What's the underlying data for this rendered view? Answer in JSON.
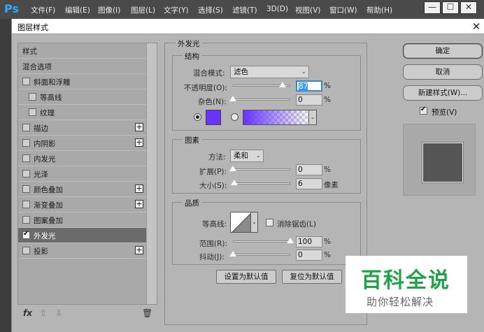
{
  "app": {
    "logo": "Ps",
    "menus": [
      "文件(F)",
      "编辑(E)",
      "图像(I)",
      "图层(L)",
      "文字(Y)",
      "选择(S)",
      "滤镜(T)",
      "3D(D)",
      "视图(V)",
      "窗口(W)",
      "帮助(H)"
    ],
    "window_buttons": [
      "—",
      "☐",
      "✕"
    ]
  },
  "dialog": {
    "title": "图层样式",
    "close": "✕"
  },
  "styles_list": {
    "header": "样式",
    "blend_options": "混合选项",
    "items": [
      {
        "label": "斜面和浮雕",
        "checked": false,
        "indent": false,
        "plus": false
      },
      {
        "label": "等高线",
        "checked": false,
        "indent": true,
        "plus": false
      },
      {
        "label": "纹理",
        "checked": false,
        "indent": true,
        "plus": false
      },
      {
        "label": "描边",
        "checked": false,
        "indent": false,
        "plus": true
      },
      {
        "label": "内阴影",
        "checked": false,
        "indent": false,
        "plus": true
      },
      {
        "label": "内发光",
        "checked": false,
        "indent": false,
        "plus": false
      },
      {
        "label": "光泽",
        "checked": false,
        "indent": false,
        "plus": false
      },
      {
        "label": "颜色叠加",
        "checked": false,
        "indent": false,
        "plus": true
      },
      {
        "label": "渐变叠加",
        "checked": false,
        "indent": false,
        "plus": true
      },
      {
        "label": "图案叠加",
        "checked": false,
        "indent": false,
        "plus": false
      },
      {
        "label": "外发光",
        "checked": true,
        "indent": false,
        "plus": false,
        "selected": true
      },
      {
        "label": "投影",
        "checked": false,
        "indent": false,
        "plus": true
      }
    ],
    "plus_symbol": "+",
    "footer": {
      "fx": "fx",
      "up": "⇧",
      "down": "⇩",
      "trash": "🗑"
    }
  },
  "outer_glow": {
    "title": "外发光",
    "structure": {
      "title": "结构",
      "blend_mode_label": "混合模式:",
      "blend_mode_value": "滤色",
      "opacity_label": "不透明度(O):",
      "opacity_value": "87",
      "opacity_unit": "%",
      "opacity_fraction": 0.87,
      "noise_label": "杂色(N):",
      "noise_value": "0",
      "noise_unit": "%",
      "noise_fraction": 0,
      "glow_color": "#6633ff"
    },
    "elements": {
      "title": "图素",
      "method_label": "方法:",
      "method_value": "柔和",
      "spread_label": "扩展(P):",
      "spread_value": "0",
      "spread_unit": "%",
      "spread_fraction": 0,
      "size_label": "大小(S):",
      "size_value": "6",
      "size_unit": "像素",
      "size_fraction": 0.024
    },
    "quality": {
      "title": "品质",
      "contour_label": "等高线:",
      "antialias_label": "消除锯齿(L)",
      "range_label": "范围(R):",
      "range_value": "100",
      "range_unit": "%",
      "range_fraction": 1.0,
      "jitter_label": "抖动(J):",
      "jitter_value": "0",
      "jitter_unit": "%",
      "jitter_fraction": 0
    },
    "make_default": "设置为默认值",
    "reset_default": "复位为默认值"
  },
  "buttons": {
    "ok": "确定",
    "cancel": "取消",
    "new_style": "新建样式(W)...",
    "preview_label": "预览(V)"
  },
  "watermark": {
    "big": "百科全说",
    "small": "助你轻松解决"
  }
}
